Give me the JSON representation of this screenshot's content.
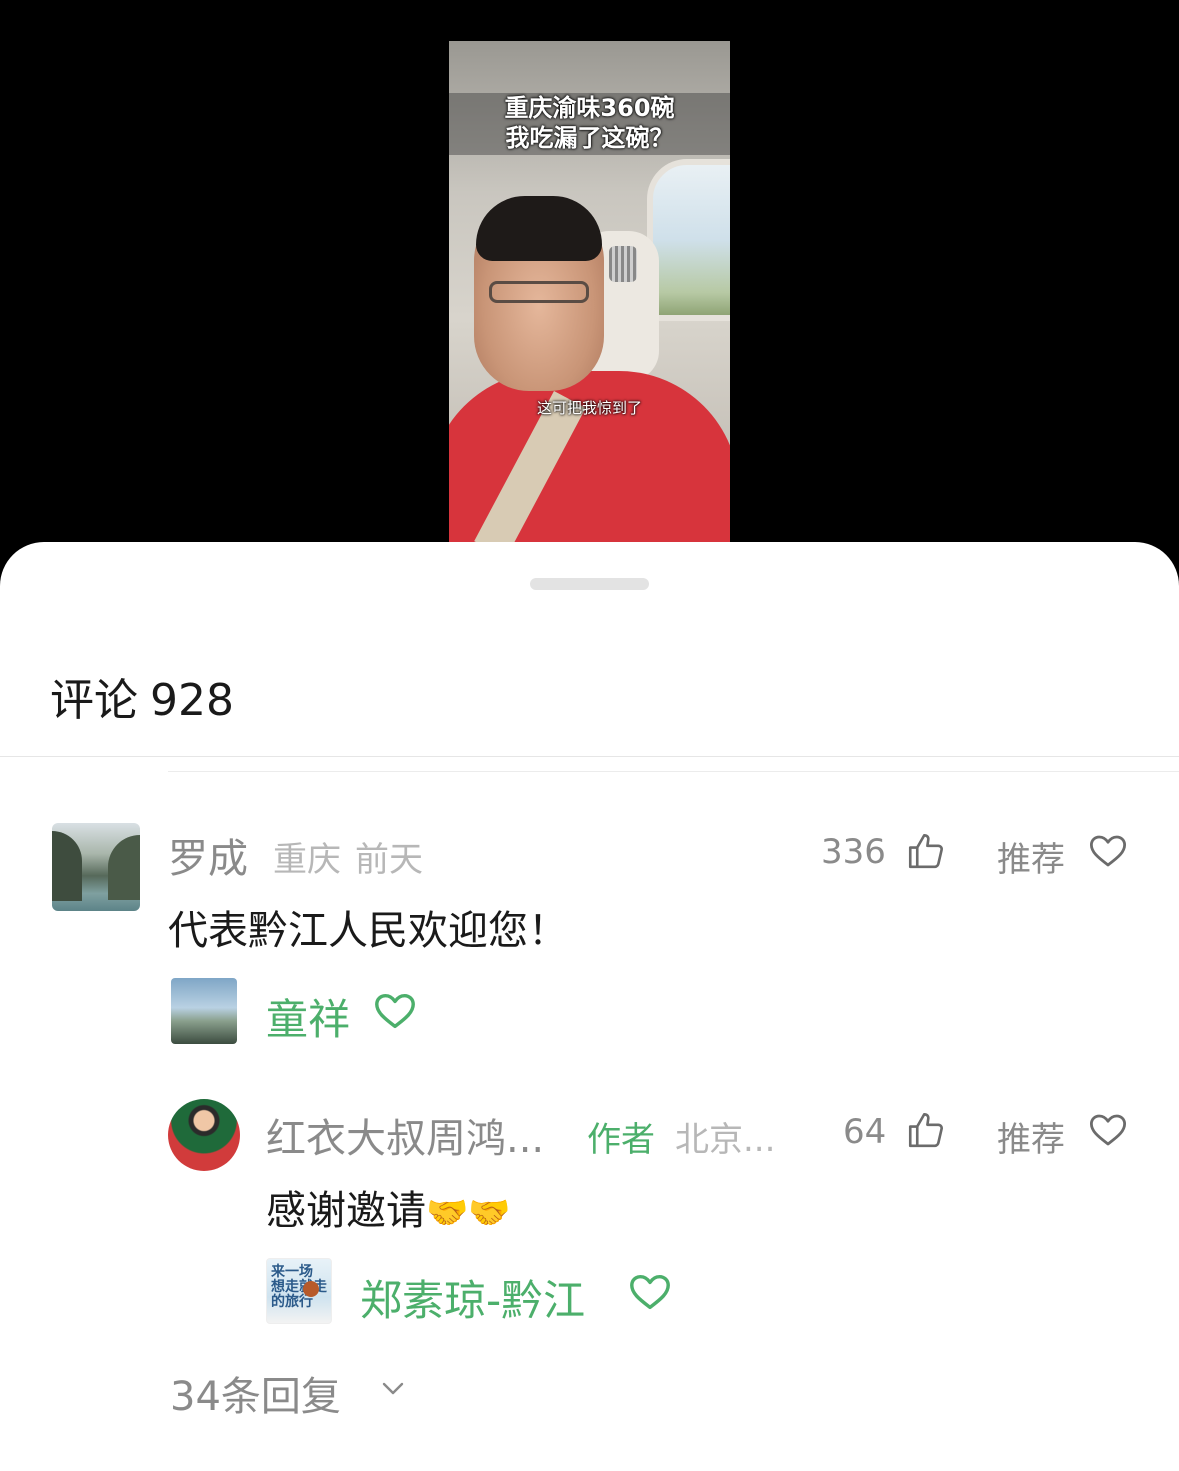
{
  "video": {
    "title_line1": "重庆渝味360碗",
    "title_line2": "我吃漏了这碗？",
    "subtitle": "这可把我惊到了"
  },
  "comments_sheet": {
    "title": "评论",
    "count": "928",
    "recommend_label": "推荐"
  },
  "comment1": {
    "username": "罗成",
    "location": "重庆",
    "time": "前天",
    "likes": "336",
    "text": "代表黔江人民欢迎您！",
    "liker_name": "童祥"
  },
  "reply1": {
    "username": "红衣大叔周鸿...",
    "author_tag": "作者",
    "location": "北京...",
    "likes": "64",
    "text": "感谢邀请",
    "emoji": "🤝🤝",
    "liker_name": "郑素琼-黔江",
    "liker_avatar_text": "来一场\n想走就走\n的旅行"
  },
  "more_replies": "34条回复",
  "colors": {
    "accent_green": "#4caf6b",
    "muted_text": "#8a8a8a",
    "primary_text": "#1a1a1a"
  },
  "icons": [
    "thumbs-up-icon",
    "heart-icon",
    "chevron-down-icon"
  ]
}
